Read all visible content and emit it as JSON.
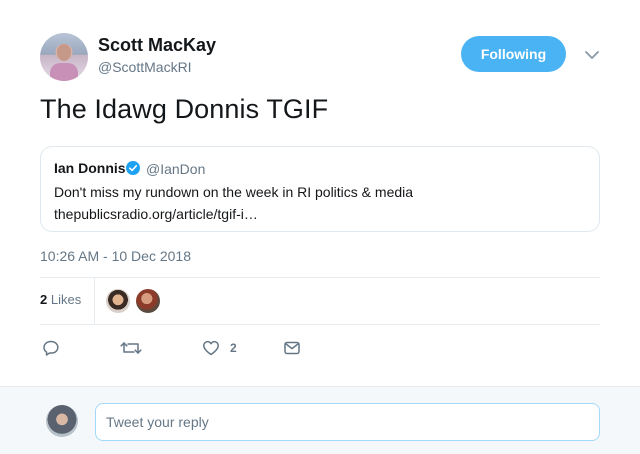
{
  "author": {
    "name": "Scott MacKay",
    "handle": "@ScottMackRI",
    "follow_label": "Following"
  },
  "tweet": {
    "text": "The Idawg Donnis TGIF",
    "timestamp": "10:26 AM - 10 Dec 2018"
  },
  "quoted": {
    "name": "Ian Donnis",
    "handle": "@IanDon",
    "text": "Don't miss my rundown on the week in RI politics & media",
    "link": "thepublicsradio.org/article/tgif-i…"
  },
  "stats": {
    "likes_count": "2",
    "likes_label": "Likes"
  },
  "actions": {
    "like_count": "2"
  },
  "reply": {
    "placeholder": "Tweet your reply"
  },
  "colors": {
    "accent": "#4ab3f4",
    "muted": "#657786",
    "text": "#14171a"
  },
  "icons": [
    "chevron-down-icon",
    "verified-badge-icon",
    "reply-icon",
    "retweet-icon",
    "heart-icon",
    "message-icon"
  ]
}
